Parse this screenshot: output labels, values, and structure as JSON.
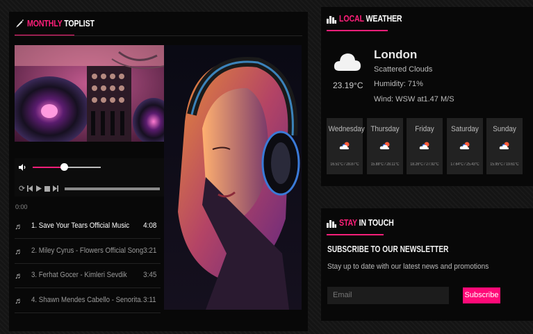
{
  "toplist": {
    "title_accent": "MONTHLY",
    "title_rest": "TOPLIST",
    "player": {
      "time": "0:00",
      "volume": 0.45,
      "progress": 0.0
    },
    "tracks": [
      {
        "name": "1. Save Your Tears Official Music",
        "duration": "4:08",
        "active": true
      },
      {
        "name": "2. Miley Cyrus - Flowers Official Song",
        "duration": "3:21"
      },
      {
        "name": "3. Ferhat Gocer - Kimleri Sevdik",
        "duration": "3:45"
      },
      {
        "name": "4. Shawn Mendes Cabello - Senorita.",
        "duration": "3:11"
      }
    ]
  },
  "weather": {
    "title_accent": "LOCAL",
    "title_rest": "WEATHER",
    "temp": "23.19°C",
    "city": "London",
    "condition": "Scattered Clouds",
    "humidity": "Humidity: 71%",
    "wind": "Wind: WSW at1.47 M/S",
    "forecast": [
      {
        "day": "Wednesday",
        "range": "16.51°C / 28.87°C"
      },
      {
        "day": "Thursday",
        "range": "15.88°C / 28.11°C"
      },
      {
        "day": "Friday",
        "range": "18.26°C / 27.92°C"
      },
      {
        "day": "Saturday",
        "range": "17.64°C / 25.43°C"
      },
      {
        "day": "Sunday",
        "range": "15.95°C / 19.61°C"
      }
    ]
  },
  "newsletter": {
    "title_accent": "STAY",
    "title_rest": "IN TOUCH",
    "heading": "SUBSCRIBE TO OUR NEWSLETTER",
    "text": "Stay up to date with our latest news and promotions",
    "email_placeholder": "Email",
    "button": "Subscribe"
  },
  "colors": {
    "accent": "#ff1f7a",
    "panel": "#080808",
    "card": "#222222"
  },
  "icons": {
    "toplist": "pen-icon",
    "weather": "city-icon",
    "newsletter": "city-icon"
  }
}
